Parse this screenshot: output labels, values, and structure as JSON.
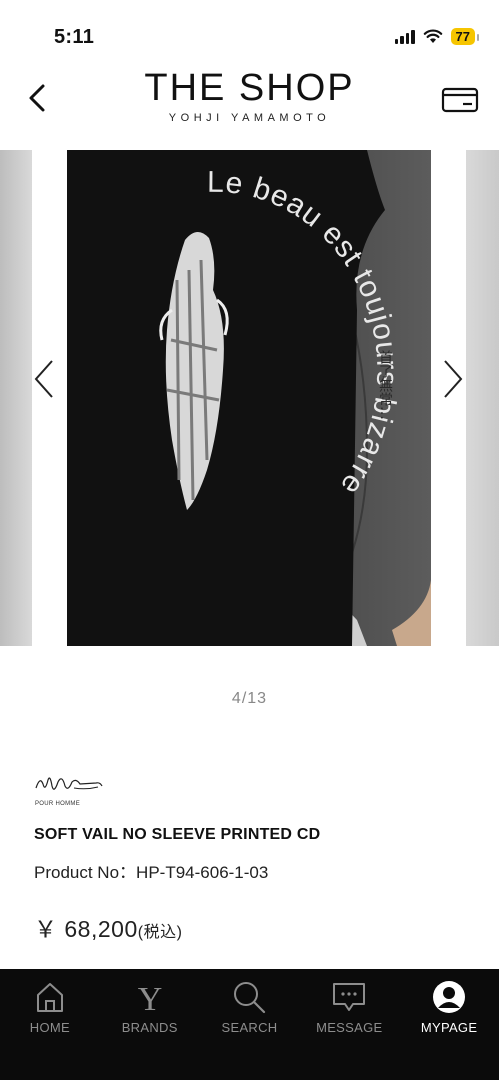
{
  "status": {
    "time": "5:11",
    "battery": "77"
  },
  "header": {
    "title": "THE SHOP",
    "subtitle": "YOHJI YAMAMOTO"
  },
  "gallery": {
    "counter": "4/13",
    "print_text": "Le beau est toujours bizarre",
    "sleeve_text": "首了無常…"
  },
  "product": {
    "logo_caption": "POUR HOMME",
    "name": "SOFT VAIL NO SLEEVE PRINTED CD",
    "number_label": "Product No：",
    "number": "HP-T94-606-1-03",
    "price": "￥ 68,200",
    "price_tax": "(税込)"
  },
  "nav": [
    {
      "label": "HOME",
      "icon": "home-icon"
    },
    {
      "label": "BRANDS",
      "icon": "brands-y-icon"
    },
    {
      "label": "SEARCH",
      "icon": "search-icon"
    },
    {
      "label": "MESSAGE",
      "icon": "message-icon"
    },
    {
      "label": "MYPAGE",
      "icon": "mypage-icon"
    }
  ],
  "colors": {
    "nav_bg": "#0b0b0b",
    "battery": "#f6c500",
    "active_label": "#ffffff",
    "inactive_label": "#8d8d8d"
  }
}
